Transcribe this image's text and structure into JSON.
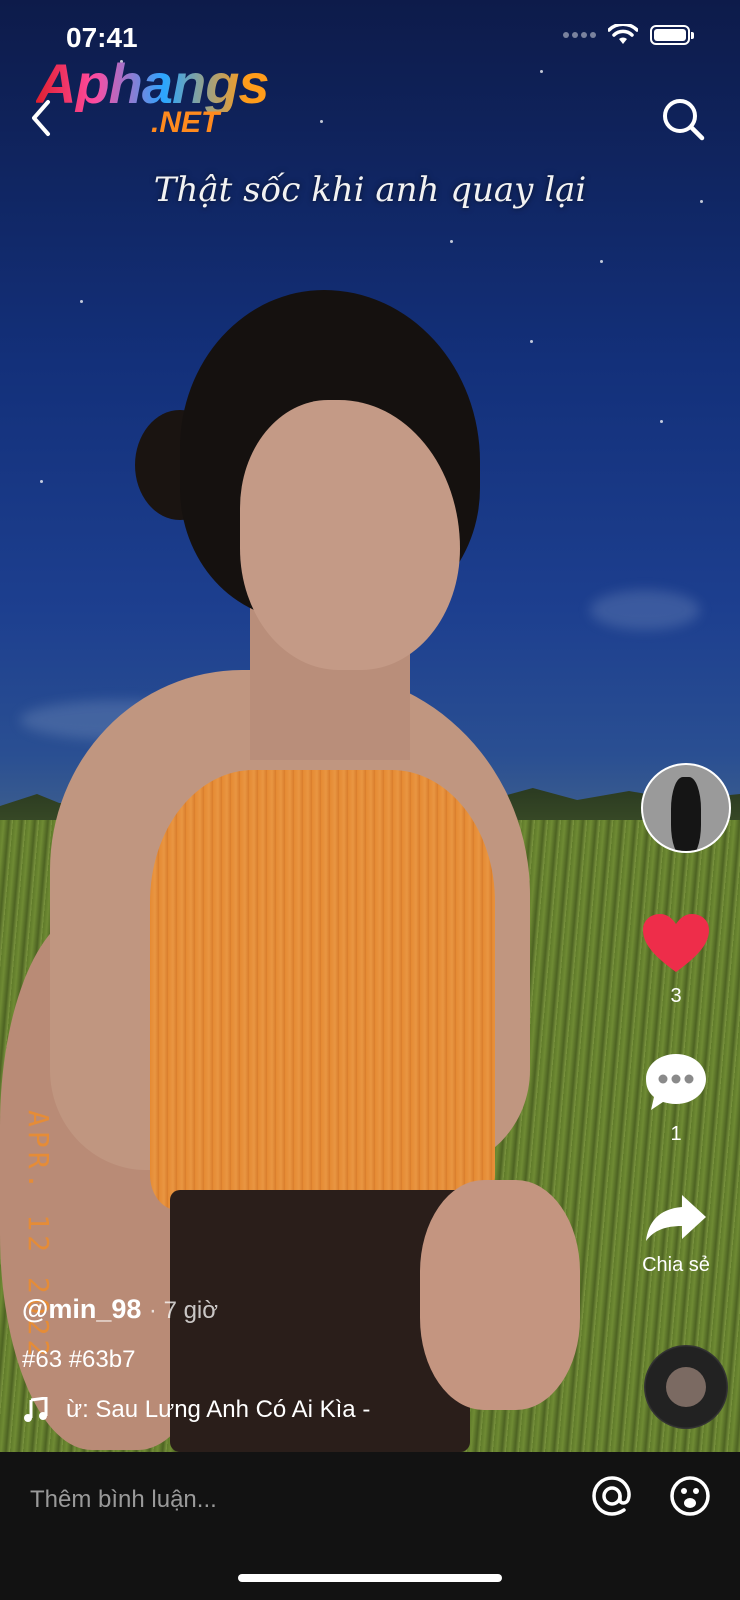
{
  "status_bar": {
    "time": "07:41"
  },
  "watermark": {
    "main": "Aphangs",
    "sub": ".NET"
  },
  "video": {
    "caption": "Thật sốc khi anh quay lại",
    "date_stamp": "APR. 12 2022"
  },
  "actions": {
    "likes": "3",
    "comments": "1",
    "share_label": "Chia sẻ"
  },
  "post": {
    "username": "@min_98",
    "time_ago": "· 7 giờ",
    "hashtags": "#63 #63b7",
    "music": "ừ: Sau Lưng Anh Có Ai Kìa -"
  },
  "comment_bar": {
    "placeholder": "Thêm bình luận..."
  },
  "colors": {
    "like": "#ee2d4a",
    "background": "#121212"
  },
  "icons": [
    "back-icon",
    "search-icon",
    "heart-icon",
    "comment-icon",
    "share-icon",
    "music-note-icon",
    "at-icon",
    "emoji-icon"
  ]
}
